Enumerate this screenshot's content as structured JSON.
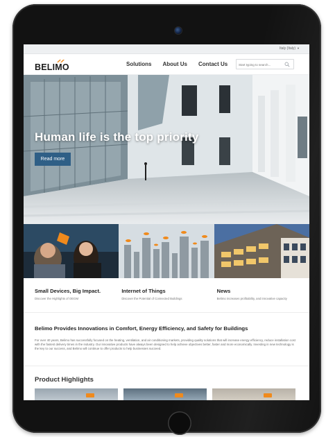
{
  "topbar": {
    "language": "Italy (Italy)",
    "language_caret": "▼"
  },
  "header": {
    "logo_text": "BELIMO",
    "nav": [
      "Solutions",
      "About Us",
      "Contact Us"
    ],
    "search_placeholder": "Start typing to search..."
  },
  "hero": {
    "title": "Human life is the top priority",
    "button": "Read more"
  },
  "teasers": [
    {
      "title": "Small Devices, Big Impact.",
      "text": "Discover the Highlights of OEGM"
    },
    {
      "title": "Internet of Things",
      "text": "Discover the Potential of Connected Buildings"
    },
    {
      "title": "News",
      "text": "Belimo increases profitability, and innovative capacity"
    }
  ],
  "section": {
    "title": "Belimo Provides Innovations in Comfort, Energy Efficiency, and Safety for Buildings",
    "body": "For over 40 years, Belimo has successfully focused on the heating, ventilation, and air conditioning markets, providing quality solutions that will increase energy efficiency, reduce installation cost with the fastest delivery times in the industry. Our innovative products have always been designed to help achieve objectives better, faster and more economically. Investing in new technology is the key to our success, and Belimo will continue to offer products to help businesses succeed."
  },
  "products": {
    "title": "Product Highlights"
  },
  "colors": {
    "brand_orange": "#f08a1c",
    "button_blue": "#2f5f86",
    "bezel": "#121212"
  }
}
